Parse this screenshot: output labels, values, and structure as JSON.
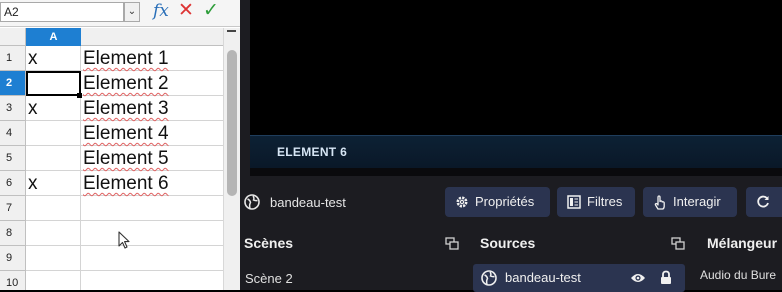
{
  "spreadsheet": {
    "name_box": "A2",
    "fx_symbol": "fx",
    "cancel_symbol": "✕",
    "accept_symbol": "✓",
    "column_headers": [
      "A"
    ],
    "rows": [
      {
        "num": "1",
        "a": "x",
        "b": "Element 1"
      },
      {
        "num": "2",
        "a": "",
        "b": "Element 2"
      },
      {
        "num": "3",
        "a": "x",
        "b": "Element 3"
      },
      {
        "num": "4",
        "a": "",
        "b": "Element 4"
      },
      {
        "num": "5",
        "a": "",
        "b": "Element 5"
      },
      {
        "num": "6",
        "a": "x",
        "b": "Element 6"
      },
      {
        "num": "7",
        "a": "",
        "b": ""
      },
      {
        "num": "8",
        "a": "",
        "b": ""
      },
      {
        "num": "9",
        "a": "",
        "b": ""
      },
      {
        "num": "10",
        "a": "",
        "b": ""
      }
    ],
    "active_row": "2",
    "accent_color": "#1e7fd2"
  },
  "obs": {
    "ticker_text": "ELEMENT 6",
    "context_source": "bandeau-test",
    "buttons": {
      "properties": "Propriétés",
      "filters": "Filtres",
      "interact": "Interagir"
    },
    "docks": {
      "scenes": "Scènes",
      "sources": "Sources",
      "mixer": "Mélangeur"
    },
    "scene_item": "Scène 2",
    "source_item": "bandeau-test",
    "mixer_item": "Audio du Bure",
    "icons": [
      "globe-icon",
      "gear-icon",
      "filter-icon",
      "hand-pointer-icon",
      "refresh-icon",
      "eye-icon",
      "lock-icon",
      "dock-float-icon"
    ]
  }
}
